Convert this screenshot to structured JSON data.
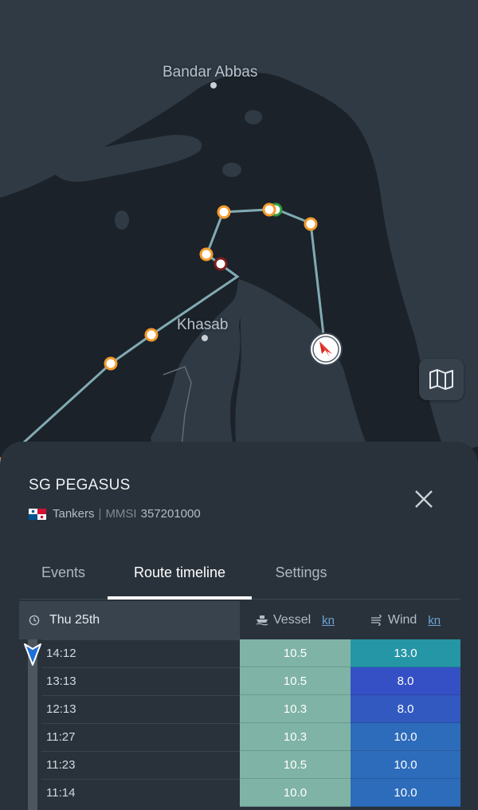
{
  "map": {
    "labels": {
      "city1": "Bandar Abbas",
      "city2": "Khasab"
    },
    "map_button_icon": "map-icon",
    "vessel_icon": "vessel-position-icon"
  },
  "panel": {
    "vessel_name": "SG PEGASUS",
    "flag_icon": "panama-flag-icon",
    "category": "Tankers",
    "separator": "|",
    "mmsi_label": "MMSI",
    "mmsi": "357201000",
    "close_icon": "close-icon"
  },
  "tabs": [
    {
      "label": "Events"
    },
    {
      "label": "Route timeline"
    },
    {
      "label": "Settings"
    }
  ],
  "active_tab": "Route timeline",
  "table": {
    "date_header": "Thu 25th",
    "vessel_header": "Vessel",
    "vessel_unit": "kn",
    "wind_header": "Wind",
    "wind_unit": "kn",
    "rows": [
      {
        "time": "14:12",
        "vessel": "10.5",
        "wind": "13.0",
        "wind_color": "#2596a6"
      },
      {
        "time": "13:13",
        "vessel": "10.5",
        "wind": "8.0",
        "wind_color": "#3550c4"
      },
      {
        "time": "12:13",
        "vessel": "10.3",
        "wind": "8.0",
        "wind_color": "#3159c0"
      },
      {
        "time": "11:27",
        "vessel": "10.3",
        "wind": "10.0",
        "wind_color": "#2d6cbb"
      },
      {
        "time": "11:23",
        "vessel": "10.5",
        "wind": "10.0",
        "wind_color": "#2d6cbb"
      },
      {
        "time": "11:14",
        "vessel": "10.0",
        "wind": "10.0",
        "wind_color": "#2d6cbb"
      }
    ]
  },
  "colors": {
    "accent_blue": "#1e6fd9",
    "vessel_cell": "#7fb3a5",
    "route_line": "#82aab2",
    "event_orange": "#f39a2b"
  }
}
